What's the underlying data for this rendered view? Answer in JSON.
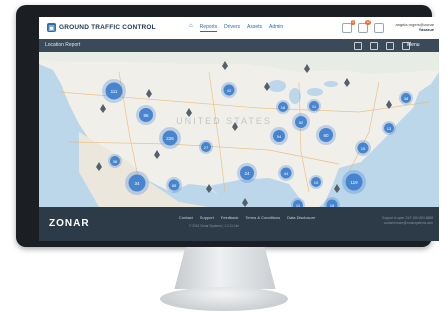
{
  "app": {
    "logo_text": "GROUND TRAFFIC CONTROL"
  },
  "nav": {
    "items": [
      {
        "label": "Reports",
        "active": true
      },
      {
        "label": "Drivers",
        "active": false
      },
      {
        "label": "Assets",
        "active": false
      },
      {
        "label": "Admin",
        "active": false
      }
    ]
  },
  "user": {
    "name": "angela.rogers@zonar",
    "role": "Yasarue"
  },
  "header_badges": {
    "alerts": "3",
    "messages": "12"
  },
  "page": {
    "title": "Location Report",
    "menu_label": "Menu"
  },
  "map": {
    "watermark": "UNITED STATES",
    "cluster_color": "#3d7fcf",
    "clusters": [
      {
        "label": "111"
      },
      {
        "label": "42"
      },
      {
        "label": "86"
      },
      {
        "label": "18"
      },
      {
        "label": "226"
      },
      {
        "label": "27"
      },
      {
        "label": "54"
      },
      {
        "label": "52"
      },
      {
        "label": "36"
      },
      {
        "label": "11"
      },
      {
        "label": "34"
      },
      {
        "label": "85"
      },
      {
        "label": "24"
      },
      {
        "label": "44"
      },
      {
        "label": "119"
      },
      {
        "label": "10"
      },
      {
        "label": "15"
      },
      {
        "label": "60"
      },
      {
        "label": "13"
      },
      {
        "label": "38"
      },
      {
        "label": "11"
      },
      {
        "label": "16"
      }
    ]
  },
  "footer": {
    "logo": "ZONAR",
    "links": [
      "Contact",
      "Support",
      "Feedback",
      "Terms & Conditions",
      "Data Disclosure"
    ],
    "copyright": "© 2016 Zonar Systems | 1.2.11.14e",
    "right_line1": "Support is open 24/7: 800-800-8888",
    "right_line2": "customercare@zonarsystems.com"
  }
}
